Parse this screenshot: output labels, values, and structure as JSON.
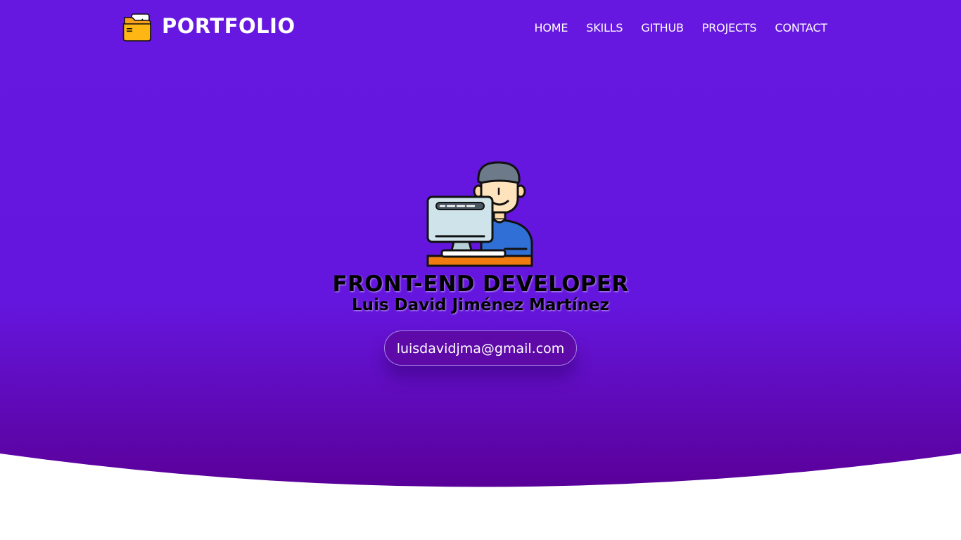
{
  "header": {
    "brand": "PORTFOLIO",
    "logo_icon": "folder-icon",
    "nav": [
      {
        "label": "HOME"
      },
      {
        "label": "SKILLS"
      },
      {
        "label": "GITHUB"
      },
      {
        "label": "PROJECTS"
      },
      {
        "label": "CONTACT"
      }
    ]
  },
  "hero": {
    "illustration": "developer-at-computer-icon",
    "title": "FRONT-END DEVELOPER",
    "name": "Luis David Jiménez Martínez",
    "email": "luisdavidjma@gmail.com"
  },
  "colors": {
    "gradient_top": "#6618e0",
    "gradient_bottom": "#5a0099",
    "background": "#ffffff",
    "button": "#5d0aa8"
  }
}
